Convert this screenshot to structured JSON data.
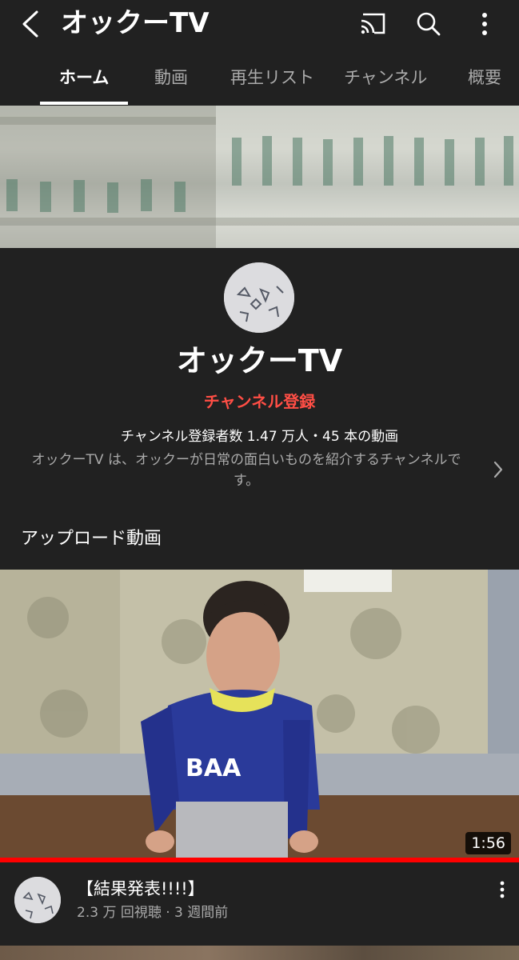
{
  "header": {
    "title": "オックーTV",
    "icons": [
      "back-arrow-icon",
      "cast-icon",
      "search-icon",
      "more-vert-icon"
    ]
  },
  "tabs": [
    {
      "label": "ホーム",
      "active": true
    },
    {
      "label": "動画"
    },
    {
      "label": "再生リスト"
    },
    {
      "label": "チャンネル"
    },
    {
      "label": "概要"
    }
  ],
  "channel": {
    "name": "オックーTV",
    "subscribe_label": "チャンネル登録",
    "stats": "チャンネル登録者数 1.47 万人・45 本の動画",
    "description": "オックーTV は、オックーが日常の面白いものを紹介するチャンネルです。"
  },
  "section": {
    "title": "アップロード動画"
  },
  "video": {
    "duration": "1:56",
    "title": "【結果発表!!!!】",
    "meta": "2.3 万 回視聴 · 3 週間前",
    "watched_fraction": 1.0
  },
  "colors": {
    "background": "#212121",
    "subscribe_red": "#ff4e45",
    "progress_red": "#ff0000",
    "secondary_text": "#aaaaaa"
  }
}
